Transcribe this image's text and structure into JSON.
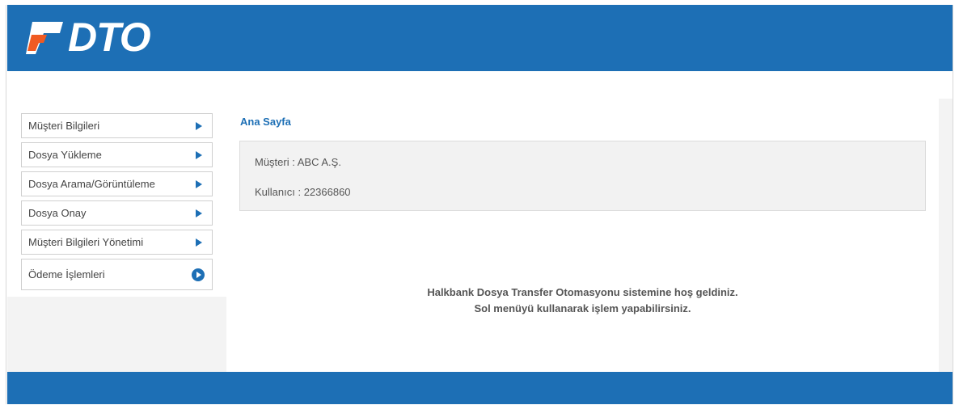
{
  "brand": {
    "logo_text": "DTO",
    "colors": {
      "primary": "#1d6fb5",
      "accent": "#f05a22"
    }
  },
  "sidebar": {
    "items": [
      {
        "label": "Müşteri Bilgileri",
        "icon": "triangle-arrow-icon"
      },
      {
        "label": "Dosya Yükleme",
        "icon": "triangle-arrow-icon"
      },
      {
        "label": "Dosya Arama/Görüntüleme",
        "icon": "triangle-arrow-icon"
      },
      {
        "label": "Dosya Onay",
        "icon": "triangle-arrow-icon"
      },
      {
        "label": "Müşteri Bilgileri Yönetimi",
        "icon": "triangle-arrow-icon"
      },
      {
        "label": "Ödeme İşlemleri",
        "icon": "circle-arrow-icon"
      }
    ]
  },
  "main": {
    "title": "Ana Sayfa",
    "customer_line": "Müşteri :  ABC A.Ş.",
    "user_line": "Kullanıcı : 22366860",
    "welcome_line1": "Halkbank Dosya Transfer Otomasyonu sistemine hoş geldiniz.",
    "welcome_line2": "Sol menüyü kullanarak işlem yapabilirsiniz."
  }
}
